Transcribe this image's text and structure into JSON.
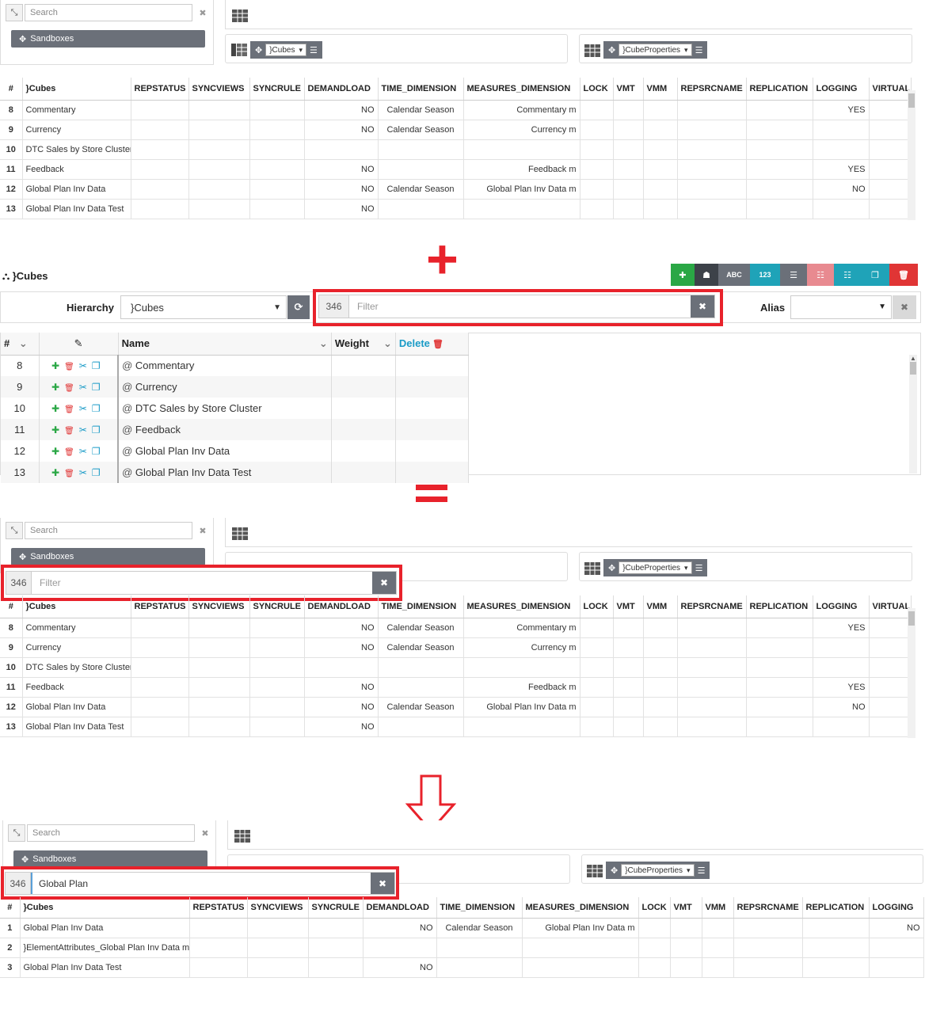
{
  "ui": {
    "search_placeholder": "Search",
    "sandboxes_label": "Sandboxes",
    "cubes_selector": "}Cubes",
    "cubeprops_selector": "}CubeProperties",
    "clear_glyph": "✖"
  },
  "colors": {
    "accent_red": "#e8222b",
    "link_blue": "#1a9bc7",
    "button_gray": "#6b7079"
  },
  "grid": {
    "columns": [
      "#",
      "}Cubes",
      "REPSTATUS",
      "SYNCVIEWS",
      "SYNCRULE",
      "DEMANDLOAD",
      "TIME_DIMENSION",
      "MEASURES_DIMENSION",
      "LOCK",
      "VMT",
      "VMM",
      "REPSRCNAME",
      "REPLICATION",
      "LOGGING",
      "VIRTUAL"
    ],
    "rows": [
      [
        "8",
        "Commentary",
        "",
        "",
        "",
        "NO",
        "Calendar Season",
        "Commentary m",
        "",
        "",
        "",
        "",
        "",
        "YES",
        ""
      ],
      [
        "9",
        "Currency",
        "",
        "",
        "",
        "NO",
        "Calendar Season",
        "Currency m",
        "",
        "",
        "",
        "",
        "",
        "",
        ""
      ],
      [
        "10",
        "DTC Sales by Store Cluster",
        "",
        "",
        "",
        "",
        "",
        "",
        "",
        "",
        "",
        "",
        "",
        "",
        ""
      ],
      [
        "11",
        "Feedback",
        "",
        "",
        "",
        "NO",
        "",
        "Feedback m",
        "",
        "",
        "",
        "",
        "",
        "YES",
        ""
      ],
      [
        "12",
        "Global Plan Inv Data",
        "",
        "",
        "",
        "NO",
        "Calendar Season",
        "Global Plan Inv Data m",
        "",
        "",
        "",
        "",
        "",
        "NO",
        ""
      ],
      [
        "13",
        "Global Plan Inv Data Test",
        "",
        "",
        "",
        "NO",
        "",
        "",
        "",
        "",
        "",
        "",
        "",
        "",
        ""
      ]
    ]
  },
  "subset_editor": {
    "title": "}Cubes",
    "toolbar": {
      "abc": "ABC",
      "num": "123"
    },
    "hierarchy_label": "Hierarchy",
    "hierarchy_value": "}Cubes",
    "filter_count": "346",
    "filter_placeholder": "Filter",
    "alias_label": "Alias",
    "headers": {
      "num": "#",
      "name": "Name",
      "weight": "Weight",
      "delete": "Delete"
    },
    "rows": [
      {
        "n": "8",
        "name": "Commentary"
      },
      {
        "n": "9",
        "name": "Currency"
      },
      {
        "n": "10",
        "name": "DTC Sales by Store Cluster"
      },
      {
        "n": "11",
        "name": "Feedback"
      },
      {
        "n": "12",
        "name": "Global Plan Inv Data"
      },
      {
        "n": "13",
        "name": "Global Plan Inv Data Test"
      }
    ],
    "at": "@"
  },
  "combined": {
    "filter_count": "346",
    "filter_placeholder": "Filter"
  },
  "result": {
    "filter_count": "346",
    "filter_value": "Global Plan",
    "columns": [
      "#",
      "}Cubes",
      "REPSTATUS",
      "SYNCVIEWS",
      "SYNCRULE",
      "DEMANDLOAD",
      "TIME_DIMENSION",
      "MEASURES_DIMENSION",
      "LOCK",
      "VMT",
      "VMM",
      "REPSRCNAME",
      "REPLICATION",
      "LOGGING"
    ],
    "rows": [
      [
        "1",
        "Global Plan Inv Data",
        "",
        "",
        "",
        "NO",
        "Calendar Season",
        "Global Plan Inv Data m",
        "",
        "",
        "",
        "",
        "",
        "NO"
      ],
      [
        "2",
        "}ElementAttributes_Global Plan Inv Data m",
        "",
        "",
        "",
        "",
        "",
        "",
        "",
        "",
        "",
        "",
        "",
        ""
      ],
      [
        "3",
        "Global Plan Inv Data Test",
        "",
        "",
        "",
        "NO",
        "",
        "",
        "",
        "",
        "",
        "",
        "",
        ""
      ]
    ]
  }
}
